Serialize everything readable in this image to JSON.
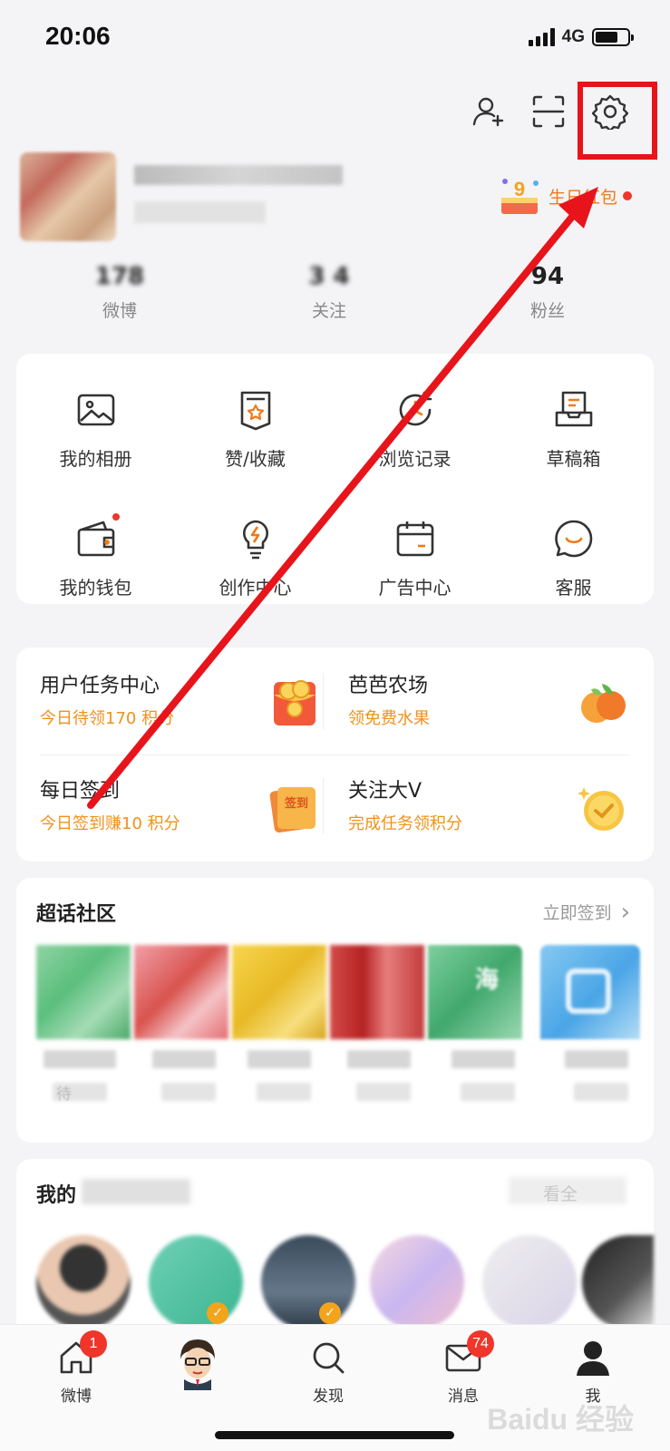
{
  "status_bar": {
    "time": "20:06",
    "network": "4G"
  },
  "profile": {
    "birthday_label": "生日红包",
    "stats": [
      {
        "value": "178",
        "label": "微博"
      },
      {
        "value": "3 4",
        "label": "关注"
      },
      {
        "value": "94",
        "label": "粉丝"
      }
    ]
  },
  "grid": {
    "items": [
      {
        "label": "我的相册",
        "icon": "album-icon"
      },
      {
        "label": "赞/收藏",
        "icon": "favorites-icon"
      },
      {
        "label": "浏览记录",
        "icon": "history-icon"
      },
      {
        "label": "草稿箱",
        "icon": "drafts-icon"
      },
      {
        "label": "我的钱包",
        "icon": "wallet-icon"
      },
      {
        "label": "创作中心",
        "icon": "bulb-icon"
      },
      {
        "label": "广告中心",
        "icon": "calendar-icon"
      },
      {
        "label": "客服",
        "icon": "service-icon"
      }
    ]
  },
  "tasks": {
    "items": [
      {
        "title": "用户任务中心",
        "subtitle": "今日待领170 积分"
      },
      {
        "title": "芭芭农场",
        "subtitle": "领免费水果"
      },
      {
        "title": "每日签到",
        "subtitle": "今日签到赚10 积分",
        "badge": "签到"
      },
      {
        "title": "关注大V",
        "subtitle": "完成任务领积分"
      }
    ]
  },
  "super_topic": {
    "title": "超话社区",
    "link": "立即签到",
    "chevron": "›",
    "tile_text_hai": "海",
    "tile_text_dai": "待"
  },
  "my_section": {
    "title_prefix": "我的",
    "link_partial": "看全"
  },
  "bottom_nav": {
    "items": [
      {
        "label": "微博",
        "badge": "1"
      },
      {
        "label": ""
      },
      {
        "label": "发现"
      },
      {
        "label": "消息",
        "badge": "74"
      },
      {
        "label": "我"
      }
    ]
  },
  "watermark": "Baidu 经验",
  "colors": {
    "accent": "#f07a18",
    "badge": "#f0352b",
    "highlight": "#e8141b"
  }
}
